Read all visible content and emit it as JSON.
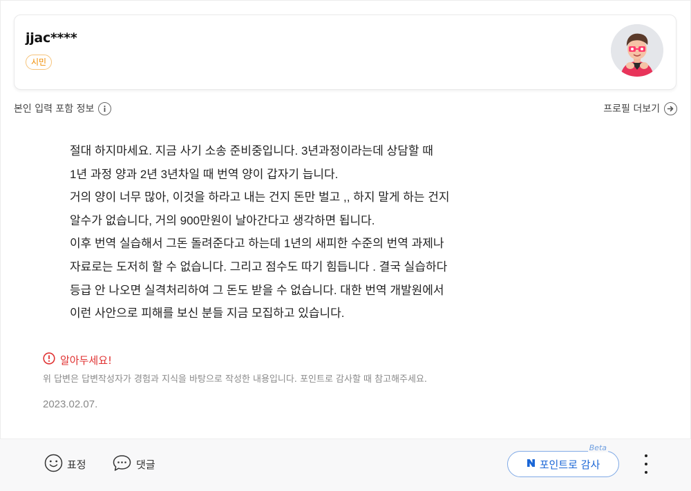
{
  "profile": {
    "username": "jjac****",
    "grade_badge": "시민",
    "avatar_icon": "character-avatar-icon"
  },
  "info_row": {
    "self_input_label": "본인 입력 포함 정보",
    "info_icon": "info-icon",
    "more_profile_label": "프로필 더보기",
    "arrow_icon": "arrow-right-circle-icon"
  },
  "answer": {
    "lines": [
      "절대 하지마세요. 지금 사기 소송 준비중입니다.  3년과정이라는데 상담할 때",
      "1년 과정 양과 2년 3년차일 때 번역 양이 갑자기 늡니다.",
      "거의 양이 너무 많아, 이것을 하라고 내는 건지 돈만 벌고 ,, 하지 말게 하는 건지",
      "알수가 없습니다, 거의 900만원이 날아간다고 생각하면 됩니다.",
      "이후 번역 실습해서 그돈 돌려준다고 하는데 1년의 새피한 수준의 번역 과제나",
      "자료로는 도저히 할 수 없습니다. 그리고 점수도 따기 힘듭니다 . 결국 실습하다",
      "등급 안 나오면  실격처리하여  그 돈도 받을 수 없습니다. 대한 번역 개발원에서",
      "이런 사안으로 피해를 보신 분들 지금 모집하고 있습니다."
    ],
    "date": "2023.02.07."
  },
  "notice": {
    "title": "알아두세요!",
    "text": "위 답변은 답변작성자가 경험과 지식을 바탕으로 작성한 내용입니다. 포인트로 감사할 때 참고해주세요.",
    "icon": "exclamation-circle-icon",
    "color": "#e03131"
  },
  "actions": {
    "expression_label": "표정",
    "comment_label": "댓글",
    "point_thanks_label": "포인트로 감사",
    "beta_label": "Beta",
    "accent_color": "#1a66d6"
  }
}
